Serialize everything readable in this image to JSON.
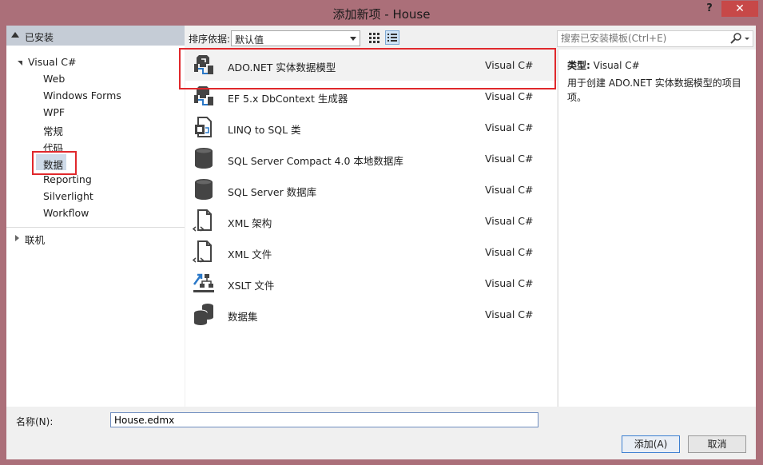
{
  "window": {
    "title": "添加新项 - House",
    "help": "?",
    "close": "✕"
  },
  "tree": {
    "header": "已安装",
    "root": "Visual C#",
    "children": [
      "Web",
      "Windows Forms",
      "WPF",
      "常规",
      "代码",
      "数据",
      "Reporting",
      "Silverlight",
      "Workflow"
    ],
    "selected": "数据",
    "online": "联机"
  },
  "toolbar": {
    "sort_label": "排序依据:",
    "sort_value": "默认值",
    "search_placeholder": "搜索已安装模板(Ctrl+E)"
  },
  "templates": [
    {
      "name": "ADO.NET 实体数据模型",
      "type": "Visual C#",
      "icon": "entity-model-icon"
    },
    {
      "name": "EF 5.x DbContext 生成器",
      "type": "Visual C#",
      "icon": "dbcontext-generator-icon"
    },
    {
      "name": "LINQ to SQL 类",
      "type": "Visual C#",
      "icon": "linq-to-sql-icon"
    },
    {
      "name": "SQL Server Compact 4.0 本地数据库",
      "type": "Visual C#",
      "icon": "database-icon"
    },
    {
      "name": "SQL Server 数据库",
      "type": "Visual C#",
      "icon": "database-icon"
    },
    {
      "name": "XML 架构",
      "type": "Visual C#",
      "icon": "xml-schema-icon"
    },
    {
      "name": "XML 文件",
      "type": "Visual C#",
      "icon": "xml-file-icon"
    },
    {
      "name": "XSLT 文件",
      "type": "Visual C#",
      "icon": "xslt-file-icon"
    },
    {
      "name": "数据集",
      "type": "Visual C#",
      "icon": "dataset-icon"
    }
  ],
  "details": {
    "type_label": "类型:",
    "type_value": "Visual C#",
    "description": "用于创建 ADO.NET 实体数据模型的项目项。"
  },
  "bottom": {
    "name_label": "名称(N):",
    "name_value": "House.edmx",
    "add_label": "添加(A)",
    "cancel_label": "取消"
  },
  "colors": {
    "frame": "#ab6f79",
    "highlight": "#e0282c",
    "close": "#c74848"
  }
}
